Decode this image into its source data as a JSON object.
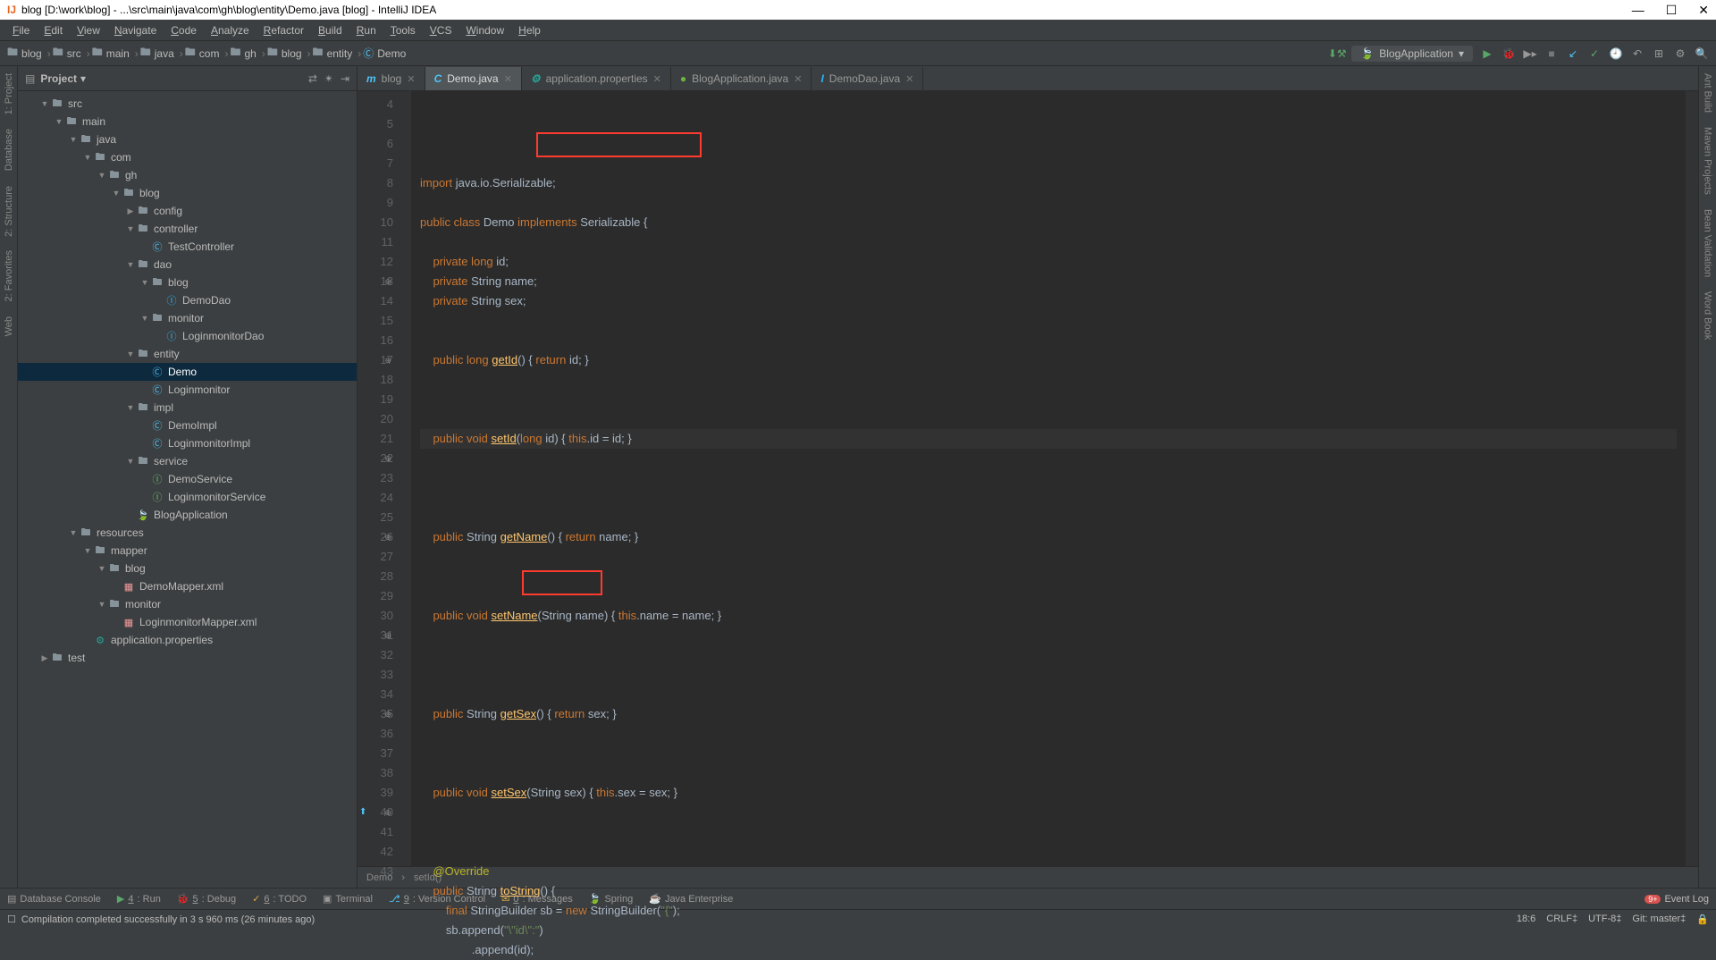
{
  "window": {
    "title": "blog [D:\\work\\blog] - ...\\src\\main\\java\\com\\gh\\blog\\entity\\Demo.java [blog] - IntelliJ IDEA"
  },
  "menus": [
    "File",
    "Edit",
    "View",
    "Navigate",
    "Code",
    "Analyze",
    "Refactor",
    "Build",
    "Run",
    "Tools",
    "VCS",
    "Window",
    "Help"
  ],
  "breadcrumbs": [
    "blog",
    "src",
    "main",
    "java",
    "com",
    "gh",
    "blog",
    "entity",
    "Demo"
  ],
  "runConfig": {
    "name": "BlogApplication"
  },
  "projectPanel": {
    "title": "Project"
  },
  "tree": [
    {
      "d": 1,
      "exp": true,
      "ico": "fld",
      "label": "src"
    },
    {
      "d": 2,
      "exp": true,
      "ico": "fld",
      "label": "main"
    },
    {
      "d": 3,
      "exp": true,
      "ico": "fld",
      "label": "java"
    },
    {
      "d": 4,
      "exp": true,
      "ico": "fld",
      "label": "com"
    },
    {
      "d": 5,
      "exp": true,
      "ico": "fld",
      "label": "gh"
    },
    {
      "d": 6,
      "exp": true,
      "ico": "fld",
      "label": "blog"
    },
    {
      "d": 7,
      "exp": false,
      "ico": "fld",
      "label": "config"
    },
    {
      "d": 7,
      "exp": true,
      "ico": "fld",
      "label": "controller"
    },
    {
      "d": 8,
      "ico": "cls-ico",
      "label": "TestController"
    },
    {
      "d": 7,
      "exp": true,
      "ico": "fld",
      "label": "dao"
    },
    {
      "d": 8,
      "exp": true,
      "ico": "fld",
      "label": "blog"
    },
    {
      "d": 9,
      "ico": "itf-ico",
      "label": "DemoDao"
    },
    {
      "d": 8,
      "exp": true,
      "ico": "fld",
      "label": "monitor"
    },
    {
      "d": 9,
      "ico": "itf-ico",
      "label": "LoginmonitorDao"
    },
    {
      "d": 7,
      "exp": true,
      "ico": "fld",
      "label": "entity"
    },
    {
      "d": 8,
      "ico": "cls-ico",
      "label": "Demo",
      "sel": true
    },
    {
      "d": 8,
      "ico": "cls-ico",
      "label": "Loginmonitor"
    },
    {
      "d": 7,
      "exp": true,
      "ico": "fld",
      "label": "impl"
    },
    {
      "d": 8,
      "ico": "cls-ico",
      "label": "DemoImpl"
    },
    {
      "d": 8,
      "ico": "cls-ico",
      "label": "LoginmonitorImpl"
    },
    {
      "d": 7,
      "exp": true,
      "ico": "fld",
      "label": "service"
    },
    {
      "d": 8,
      "ico": "svc-ico",
      "label": "DemoService"
    },
    {
      "d": 8,
      "ico": "svc-ico",
      "label": "LoginmonitorService"
    },
    {
      "d": 7,
      "ico": "spring-ico",
      "label": "BlogApplication"
    },
    {
      "d": 3,
      "exp": true,
      "ico": "fld",
      "label": "resources"
    },
    {
      "d": 4,
      "exp": true,
      "ico": "fld",
      "label": "mapper"
    },
    {
      "d": 5,
      "exp": true,
      "ico": "fld",
      "label": "blog"
    },
    {
      "d": 6,
      "ico": "xml-ico",
      "label": "DemoMapper.xml"
    },
    {
      "d": 5,
      "exp": true,
      "ico": "fld",
      "label": "monitor"
    },
    {
      "d": 6,
      "ico": "xml-ico",
      "label": "LoginmonitorMapper.xml"
    },
    {
      "d": 4,
      "ico": "prop-ico",
      "label": "application.properties"
    },
    {
      "d": 1,
      "exp": false,
      "ico": "fld",
      "label": "test"
    }
  ],
  "tabs": [
    {
      "label": "blog",
      "ico": "m",
      "color": "#4fc3f7"
    },
    {
      "label": "Demo.java",
      "ico": "C",
      "color": "#4fc3f7",
      "active": true
    },
    {
      "label": "application.properties",
      "ico": "⚙",
      "color": "#26a69a"
    },
    {
      "label": "BlogApplication.java",
      "ico": "●",
      "color": "#6db33f"
    },
    {
      "label": "DemoDao.java",
      "ico": "I",
      "color": "#29b6f6"
    }
  ],
  "lineStart": 4,
  "codeLines": [
    {
      "html": "<span class='kw'>import</span> java.io.Serializable;"
    },
    {
      "html": ""
    },
    {
      "html": "<span class='kw'>public class</span> Demo <span class='kw'>implements</span> Serializable {"
    },
    {
      "html": ""
    },
    {
      "html": "    <span class='kw'>private long</span> id;"
    },
    {
      "html": "    <span class='kw'>private</span> String name;"
    },
    {
      "html": "    <span class='kw'>private</span> String sex;"
    },
    {
      "html": ""
    },
    {
      "html": ""
    },
    {
      "html": "    <span class='kw'>public long</span> <span class='fn'>getId</span>() { <span class='kw'>return</span> id; }",
      "fold": true
    },
    {
      "html": ""
    },
    {
      "html": ""
    },
    {
      "html": ""
    },
    {
      "html": "    <span class='kw'>public void</span> <span class='fn'>setId</span>(<span class='kw'>long</span> id) { <span class='kw'>this</span>.id = id; }",
      "fold": true,
      "cursor": true
    },
    {
      "html": ""
    },
    {
      "html": ""
    },
    {
      "html": ""
    },
    {
      "html": ""
    },
    {
      "html": "    <span class='kw'>public</span> String <span class='fn'>getName</span>() { <span class='kw'>return</span> name; }",
      "fold": true
    },
    {
      "html": ""
    },
    {
      "html": ""
    },
    {
      "html": ""
    },
    {
      "html": "    <span class='kw'>public void</span> <span class='fn'>setName</span>(String name) { <span class='kw'>this</span>.name = name; }",
      "fold": true
    },
    {
      "html": ""
    },
    {
      "html": ""
    },
    {
      "html": ""
    },
    {
      "html": ""
    },
    {
      "html": "    <span class='kw'>public</span> String <span class='fn'>getSex</span>() { <span class='kw'>return</span> sex; }",
      "fold": true
    },
    {
      "html": ""
    },
    {
      "html": ""
    },
    {
      "html": ""
    },
    {
      "html": "    <span class='kw'>public void</span> <span class='fn'>setSex</span>(String sex) { <span class='kw'>this</span>.sex = sex; }",
      "fold": true
    },
    {
      "html": ""
    },
    {
      "html": ""
    },
    {
      "html": ""
    },
    {
      "html": "    <span class='ann'>@Override</span>"
    },
    {
      "html": "    <span class='kw'>public</span> String <span class='fn'>toString</span>() {",
      "fold": true,
      "override": true
    },
    {
      "html": "        <span class='kw'>final</span> StringBuilder sb = <span class='kw'>new</span> StringBuilder(<span class='str'>\"{\"</span>);"
    },
    {
      "html": "        sb.append(<span class='str'>\"\\\"id\\\":\"</span>)"
    },
    {
      "html": "                .append(id);"
    }
  ],
  "lineNums": [
    4,
    5,
    6,
    7,
    8,
    9,
    10,
    11,
    "",
    13,
    "",
    "",
    17,
    "",
    20,
    21,
    22,
    "",
    25,
    26,
    "",
    29,
    30,
    "",
    34,
    35,
    "",
    38,
    39,
    40,
    41,
    42,
    43
  ],
  "editorBreadcrumb": [
    "Demo",
    "setId()"
  ],
  "bottomTools": [
    {
      "ico": "▤",
      "label": "Database Console"
    },
    {
      "ico": "▶",
      "label": "4: Run",
      "color": "#59a869"
    },
    {
      "ico": "🐞",
      "label": "5: Debug",
      "color": "#59a869"
    },
    {
      "ico": "✓",
      "label": "6: TODO",
      "color": "#d9a94a"
    },
    {
      "ico": "▣",
      "label": "Terminal"
    },
    {
      "ico": "⎇",
      "label": "9: Version Control",
      "color": "#4fc3f7"
    },
    {
      "ico": "✉",
      "label": "0: Messages",
      "color": "#d9a94a"
    },
    {
      "ico": "🍃",
      "label": "Spring",
      "color": "#6db33f"
    },
    {
      "ico": "☕",
      "label": "Java Enterprise"
    }
  ],
  "status": {
    "message": "Compilation completed successfully in 3 s 960 ms (26 minutes ago)",
    "pos": "18:6",
    "lf": "CRLF‡",
    "enc": "UTF-8‡",
    "git": "Git: master‡",
    "lock": "🔒"
  },
  "eventLog": "Event Log",
  "rightTools": [
    "Ant Build",
    "Maven Projects",
    "Bean Validation",
    "Word Book"
  ],
  "leftTools": [
    "1: Project",
    "Database",
    "2: Structure",
    "2: Favorites",
    "Web"
  ]
}
